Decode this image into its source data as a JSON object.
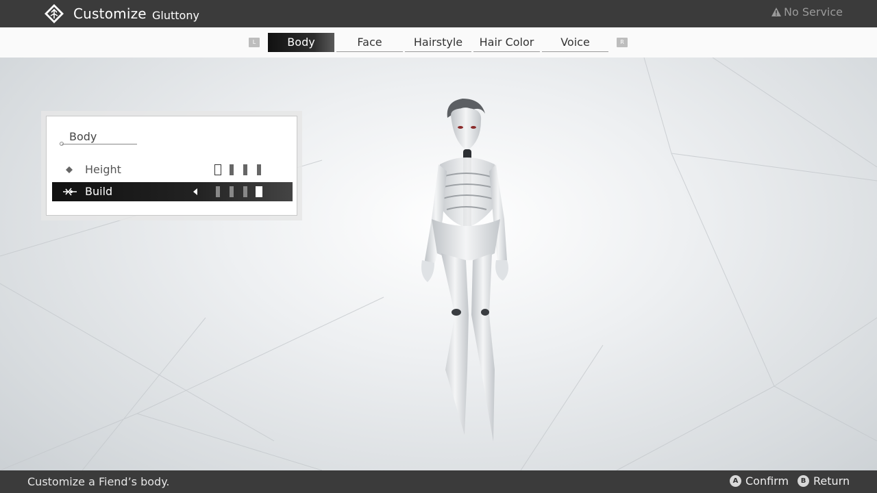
{
  "header": {
    "title": "Customize",
    "subtitle": "Gluttony",
    "network_status": "No Service",
    "logo_icon": "emblem-icon"
  },
  "tabs": {
    "left_shoulder": "L",
    "right_shoulder": "R",
    "items": [
      {
        "label": "Body",
        "active": true
      },
      {
        "label": "Face",
        "active": false
      },
      {
        "label": "Hairstyle",
        "active": false
      },
      {
        "label": "Hair Color",
        "active": false
      },
      {
        "label": "Voice",
        "active": false
      }
    ]
  },
  "panel": {
    "title": "Body",
    "options": [
      {
        "label": "Height",
        "level": 1,
        "levels": 4,
        "selected": false
      },
      {
        "label": "Build",
        "level": 4,
        "levels": 4,
        "selected": true
      }
    ]
  },
  "footer": {
    "help": "Customize a Fiend’s body.",
    "confirm_button": "A",
    "confirm_label": "Confirm",
    "return_button": "B",
    "return_label": "Return"
  },
  "colors": {
    "bar": "#3b3b3b",
    "active_tab": "#111111",
    "background": "#e8ebed"
  }
}
